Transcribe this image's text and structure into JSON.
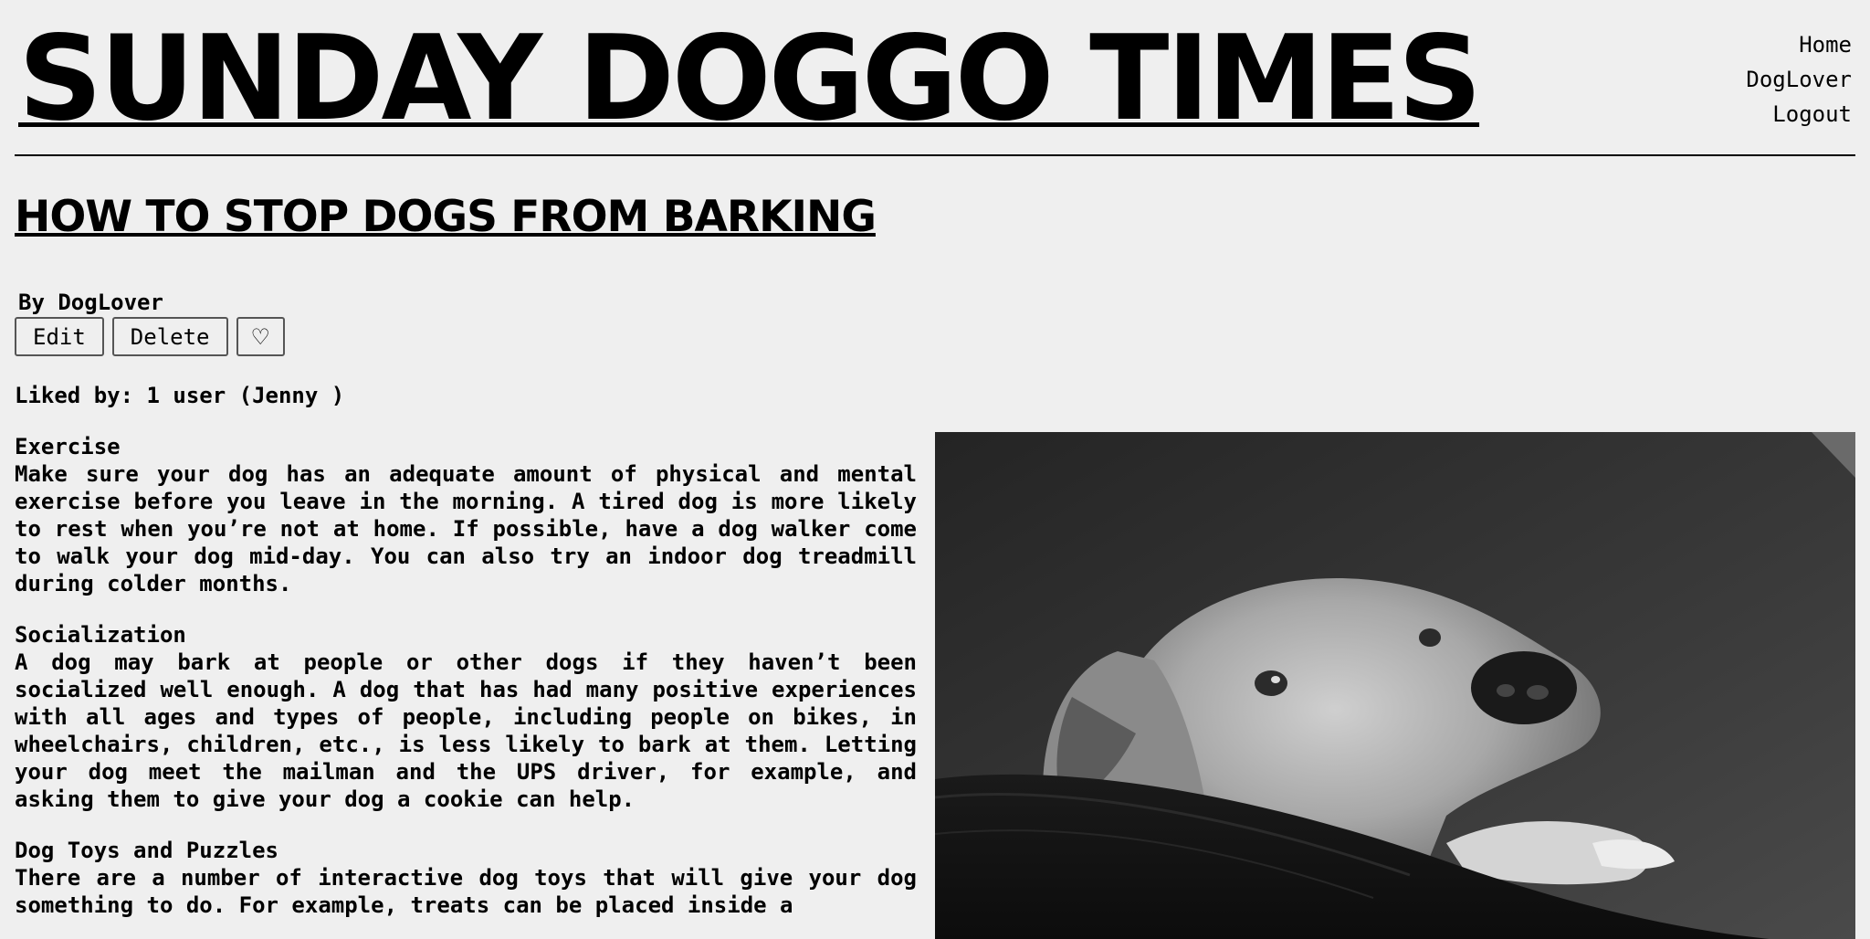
{
  "site": {
    "title": "SUNDAY DOGGO TIMES",
    "nav": [
      "Home",
      "DogLover",
      "Logout"
    ]
  },
  "article": {
    "title": "HOW TO STOP DOGS FROM BARKING",
    "byline": "By DogLover",
    "actions": {
      "edit": "Edit",
      "delete": "Delete",
      "like": "♡"
    },
    "liked_by": "Liked by: 1 user (Jenny )",
    "sections": [
      {
        "heading": "Exercise",
        "text": "Make sure your dog has an adequate amount of physical and mental exercise before you leave in the morning. A tired dog is more likely to rest when you’re not at home. If possible, have a dog walker come to walk your dog mid-day. You can also try an indoor dog treadmill during colder months."
      },
      {
        "heading": "Socialization",
        "text": "A dog may bark at people or other dogs if they haven’t been socialized well enough. A dog that has had many positive experiences with all ages and types of people, including people on bikes, in wheelchairs, children, etc., is less likely to bark at them. Letting your dog meet the mailman and the UPS driver, for example, and asking them to give your dog a cookie can help."
      },
      {
        "heading": "Dog Toys and Puzzles",
        "text": "There are a number of interactive dog toys that will give your dog something to do. For example, treats can be placed inside a"
      }
    ]
  }
}
